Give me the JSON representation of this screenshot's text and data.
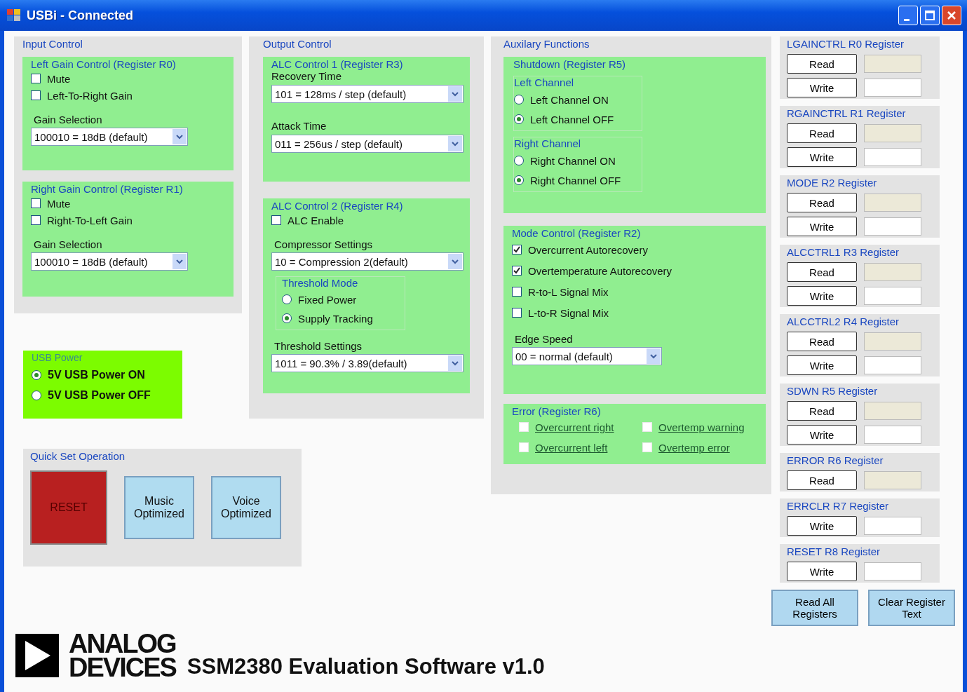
{
  "window": {
    "title": "USBi - Connected"
  },
  "input_control": {
    "title": "Input Control",
    "groups": [
      {
        "title": "Left Gain Control (Register R0)",
        "checkboxes": [
          {
            "label": "Mute",
            "checked": false
          },
          {
            "label": "Left-To-Right Gain",
            "checked": false
          }
        ],
        "select_label": "Gain Selection",
        "select_value": "100010 = 18dB (default)"
      },
      {
        "title": "Right Gain Control (Register R1)",
        "checkboxes": [
          {
            "label": "Mute",
            "checked": false
          },
          {
            "label": "Right-To-Left Gain",
            "checked": false
          }
        ],
        "select_label": "Gain Selection",
        "select_value": "100010 = 18dB (default)"
      }
    ]
  },
  "usb_power": {
    "title": "USB Power",
    "options": [
      {
        "label": "5V USB Power ON",
        "selected": true
      },
      {
        "label": "5V USB Power OFF",
        "selected": false
      }
    ]
  },
  "quick_set": {
    "title": "Quick Set Operation",
    "buttons": [
      {
        "label": "RESET",
        "kind": "reset"
      },
      {
        "label": "Music Optimized",
        "kind": "preset"
      },
      {
        "label": "Voice Optimized",
        "kind": "preset"
      }
    ]
  },
  "output_control": {
    "title": "Output Control",
    "alc1": {
      "title": "ALC Control 1 (Register R3)",
      "fields": [
        {
          "label": "Recovery Time",
          "value": "101 = 128ms / step (default)"
        },
        {
          "label": "Attack Time",
          "value": "011 = 256us / step (default)"
        }
      ]
    },
    "alc2": {
      "title": "ALC Control 2 (Register R4)",
      "enable": {
        "label": "ALC Enable",
        "checked": false
      },
      "compressor": {
        "label": "Compressor Settings",
        "value": "10 = Compression 2(default)"
      },
      "threshold_mode": {
        "title": "Threshold Mode",
        "options": [
          {
            "label": "Fixed Power",
            "selected": false
          },
          {
            "label": "Supply Tracking",
            "selected": true
          }
        ]
      },
      "threshold": {
        "label": "Threshold Settings",
        "value": "1011 = 90.3% / 3.89(default)"
      }
    }
  },
  "auxiliary": {
    "title": "Auxilary Functions",
    "shutdown": {
      "title": "Shutdown (Register R5)",
      "channels": [
        {
          "title": "Left Channel",
          "options": [
            {
              "label": "Left Channel ON",
              "selected": false
            },
            {
              "label": "Left Channel OFF",
              "selected": true
            }
          ]
        },
        {
          "title": "Right Channel",
          "options": [
            {
              "label": "Right Channel ON",
              "selected": false
            },
            {
              "label": "Right Channel OFF",
              "selected": true
            }
          ]
        }
      ]
    },
    "mode": {
      "title": "Mode Control (Register R2)",
      "checkboxes": [
        {
          "label": "Overcurrent Autorecovery",
          "checked": true
        },
        {
          "label": "Overtemperature Autorecovery",
          "checked": true
        },
        {
          "label": "R-to-L Signal Mix",
          "checked": false
        },
        {
          "label": "L-to-R Signal Mix",
          "checked": false
        }
      ],
      "edge_label": "Edge Speed",
      "edge_value": "00 = normal (default)"
    },
    "error": {
      "title": "Error (Register R6)",
      "flags": [
        {
          "label": "Overcurrent right",
          "checked": false
        },
        {
          "label": "Overtemp warning",
          "checked": false
        },
        {
          "label": "Overcurrent left",
          "checked": false
        },
        {
          "label": "Overtemp error",
          "checked": false
        }
      ]
    }
  },
  "registers": [
    {
      "title": "LGAINCTRL R0 Register",
      "rows": [
        {
          "button": "Read",
          "kind": "read"
        },
        {
          "button": "Write",
          "kind": "write"
        }
      ]
    },
    {
      "title": "RGAINCTRL R1 Register",
      "rows": [
        {
          "button": "Read",
          "kind": "read"
        },
        {
          "button": "Write",
          "kind": "write"
        }
      ]
    },
    {
      "title": "MODE R2 Register",
      "rows": [
        {
          "button": "Read",
          "kind": "read"
        },
        {
          "button": "Write",
          "kind": "write"
        }
      ]
    },
    {
      "title": "ALCCTRL1 R3 Register",
      "rows": [
        {
          "button": "Read",
          "kind": "read"
        },
        {
          "button": "Write",
          "kind": "write"
        }
      ]
    },
    {
      "title": "ALCCTRL2 R4 Register",
      "rows": [
        {
          "button": "Read",
          "kind": "read"
        },
        {
          "button": "Write",
          "kind": "write"
        }
      ]
    },
    {
      "title": "SDWN R5 Register",
      "rows": [
        {
          "button": "Read",
          "kind": "read"
        },
        {
          "button": "Write",
          "kind": "write"
        }
      ]
    },
    {
      "title": "ERROR R6 Register",
      "rows": [
        {
          "button": "Read",
          "kind": "read"
        }
      ]
    },
    {
      "title": "ERRCLR R7 Register",
      "rows": [
        {
          "button": "Write",
          "kind": "write"
        }
      ]
    },
    {
      "title": "RESET R8 Register",
      "rows": [
        {
          "button": "Write",
          "kind": "write"
        }
      ]
    }
  ],
  "logo": {
    "line1": "ANALOG",
    "line2": "DEVICES"
  },
  "app_title": "SSM2380 Evaluation Software v1.0",
  "actions": [
    "Read All Registers",
    "Clear Register Text"
  ]
}
